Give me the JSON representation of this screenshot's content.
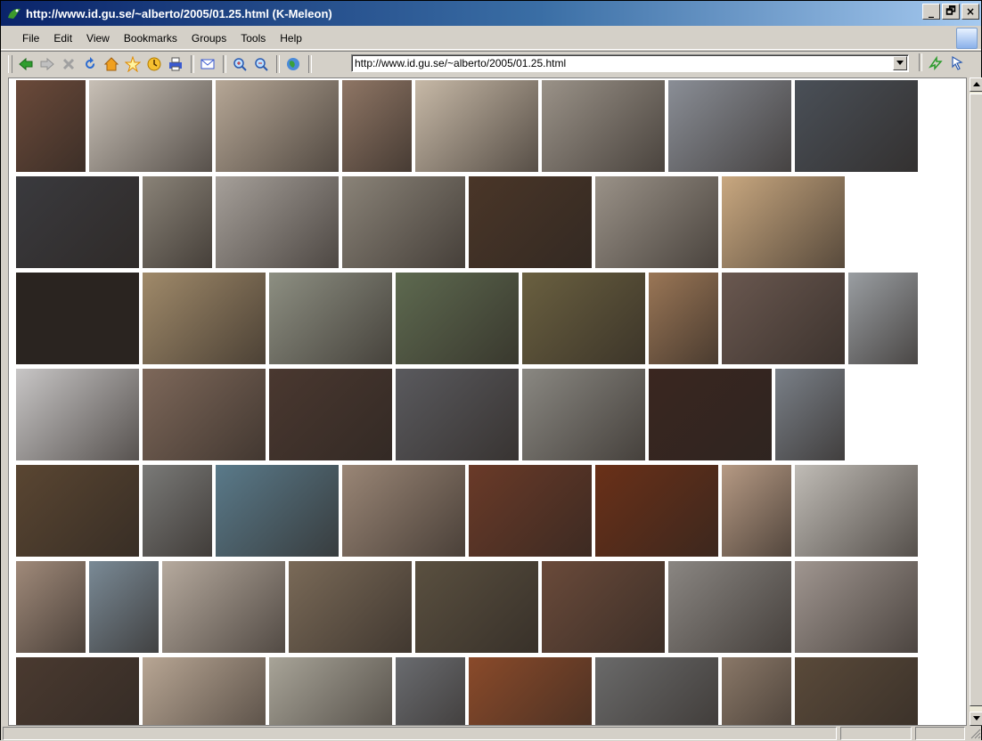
{
  "window": {
    "title": "http://www.id.gu.se/~alberto/2005/01.25.html (K-Meleon)",
    "controls": [
      "_",
      "🗗",
      "×"
    ]
  },
  "menubar": {
    "items": [
      "File",
      "Edit",
      "View",
      "Bookmarks",
      "Groups",
      "Tools",
      "Help"
    ]
  },
  "toolbar": {
    "buttons": [
      "back-icon",
      "forward-icon",
      "stop-icon",
      "reload-icon",
      "home-icon",
      "bookmark-star-icon",
      "history-icon",
      "print-icon",
      "mail-icon",
      "zoom-in-icon",
      "zoom-out-icon",
      "globe-icon"
    ],
    "go_buttons": [
      "go-icon",
      "link-arrow-icon"
    ]
  },
  "address": {
    "url": "http://www.id.gu.se/~alberto/2005/01.25.html"
  },
  "gallery": {
    "description_rows": 7,
    "rows": [
      [
        {
          "w": 78,
          "c": "#6b4a3a"
        },
        {
          "w": 138,
          "c": "#c8c0b6"
        },
        {
          "w": 138,
          "c": "#b6a796"
        },
        {
          "w": 78,
          "c": "#8f7665"
        },
        {
          "w": 138,
          "c": "#c7b9a7"
        },
        {
          "w": 138,
          "c": "#9a9288"
        },
        {
          "w": 138,
          "c": "#8a8e96"
        },
        {
          "w": 138,
          "c": "#4a5058"
        }
      ],
      [
        {
          "w": 138,
          "c": "#3a3a3e"
        },
        {
          "w": 78,
          "c": "#8a8378"
        },
        {
          "w": 138,
          "c": "#a6a09a"
        },
        {
          "w": 138,
          "c": "#8a8378"
        },
        {
          "w": 138,
          "c": "#4a3628"
        },
        {
          "w": 138,
          "c": "#9a9288"
        },
        {
          "w": 138,
          "c": "#c9a880"
        }
      ],
      [
        {
          "w": 138,
          "c": "#2a2420"
        },
        {
          "w": 138,
          "c": "#a08a6a"
        },
        {
          "w": 138,
          "c": "#8d8f82"
        },
        {
          "w": 138,
          "c": "#5e6a50"
        },
        {
          "w": 138,
          "c": "#6a6040"
        },
        {
          "w": 78,
          "c": "#9a7656"
        },
        {
          "w": 138,
          "c": "#6a5850"
        },
        {
          "w": 78,
          "c": "#9a9ea2"
        }
      ],
      [
        {
          "w": 138,
          "c": "#c8c6c6"
        },
        {
          "w": 138,
          "c": "#7e685a"
        },
        {
          "w": 138,
          "c": "#4a3830"
        },
        {
          "w": 138,
          "c": "#5a5a5e"
        },
        {
          "w": 138,
          "c": "#8a8882"
        },
        {
          "w": 138,
          "c": "#3a2620"
        },
        {
          "w": 78,
          "c": "#7a8088"
        }
      ],
      [
        {
          "w": 138,
          "c": "#5a4632"
        },
        {
          "w": 78,
          "c": "#7a7a78"
        },
        {
          "w": 138,
          "c": "#5a7a8a"
        },
        {
          "w": 138,
          "c": "#9a8676"
        },
        {
          "w": 138,
          "c": "#6a3a28"
        },
        {
          "w": 138,
          "c": "#6a3018"
        },
        {
          "w": 78,
          "c": "#b69a84"
        },
        {
          "w": 138,
          "c": "#c0bcb6"
        }
      ],
      [
        {
          "w": 78,
          "c": "#a08a7a"
        },
        {
          "w": 78,
          "c": "#7a8a96"
        },
        {
          "w": 138,
          "c": "#b6aa9e"
        },
        {
          "w": 138,
          "c": "#7a6a58"
        },
        {
          "w": 138,
          "c": "#5a5040"
        },
        {
          "w": 138,
          "c": "#6a4a3a"
        },
        {
          "w": 138,
          "c": "#8a8682"
        },
        {
          "w": 138,
          "c": "#a09690"
        }
      ],
      [
        {
          "w": 138,
          "c": "#4a3a30"
        },
        {
          "w": 138,
          "c": "#b8a694"
        },
        {
          "w": 138,
          "c": "#a8a498"
        },
        {
          "w": 78,
          "c": "#6a6c70"
        },
        {
          "w": 138,
          "c": "#8a4a2a"
        },
        {
          "w": 138,
          "c": "#6a6a6a"
        },
        {
          "w": 78,
          "c": "#8a7868"
        },
        {
          "w": 138,
          "c": "#5a4a3a"
        }
      ]
    ]
  },
  "colors": {
    "titlebar_start": "#0a246a",
    "titlebar_end": "#a6caf0",
    "chrome": "#d4d0c8"
  }
}
